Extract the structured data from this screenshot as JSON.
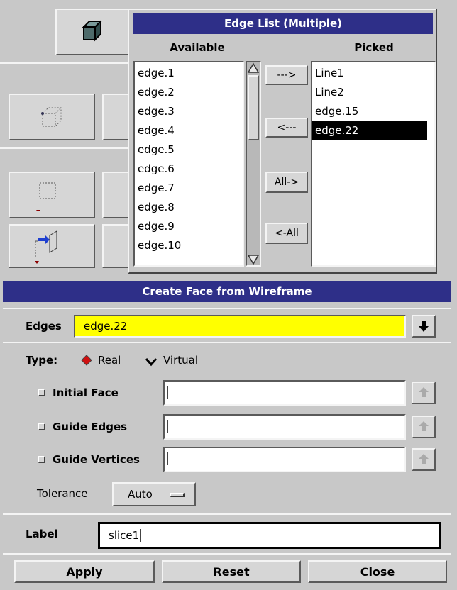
{
  "edge_list_dialog": {
    "title": "Edge List (Multiple)",
    "available_header": "Available",
    "picked_header": "Picked",
    "available_items": [
      "edge.1",
      "edge.2",
      "edge.3",
      "edge.4",
      "edge.5",
      "edge.6",
      "edge.7",
      "edge.8",
      "edge.9",
      "edge.10"
    ],
    "picked_items": [
      "Line1",
      "Line2",
      "edge.15",
      "edge.22"
    ],
    "selected_picked": "edge.22",
    "buttons": {
      "add": "--->",
      "remove": "<---",
      "add_all": "All->",
      "remove_all": "<-All"
    }
  },
  "create_face_panel": {
    "title": "Create Face from Wireframe",
    "edges_label": "Edges",
    "edges_value": "edge.22",
    "type_label": "Type:",
    "type_options": [
      "Real",
      "Virtual"
    ],
    "type_selected": "Real",
    "options": [
      {
        "label": "Initial Face",
        "value": ""
      },
      {
        "label": "Guide Edges",
        "value": ""
      },
      {
        "label": "Guide Vertices",
        "value": ""
      }
    ],
    "tolerance_label": "Tolerance",
    "tolerance_value": "Auto",
    "label_label": "Label",
    "label_value": "slice1",
    "buttons": {
      "apply": "Apply",
      "reset": "Reset",
      "close": "Close"
    }
  },
  "colors": {
    "titlebar": "#2e2f88",
    "highlight_field": "#ffff00",
    "panel": "#c8c8c8",
    "selection": "#000000"
  }
}
